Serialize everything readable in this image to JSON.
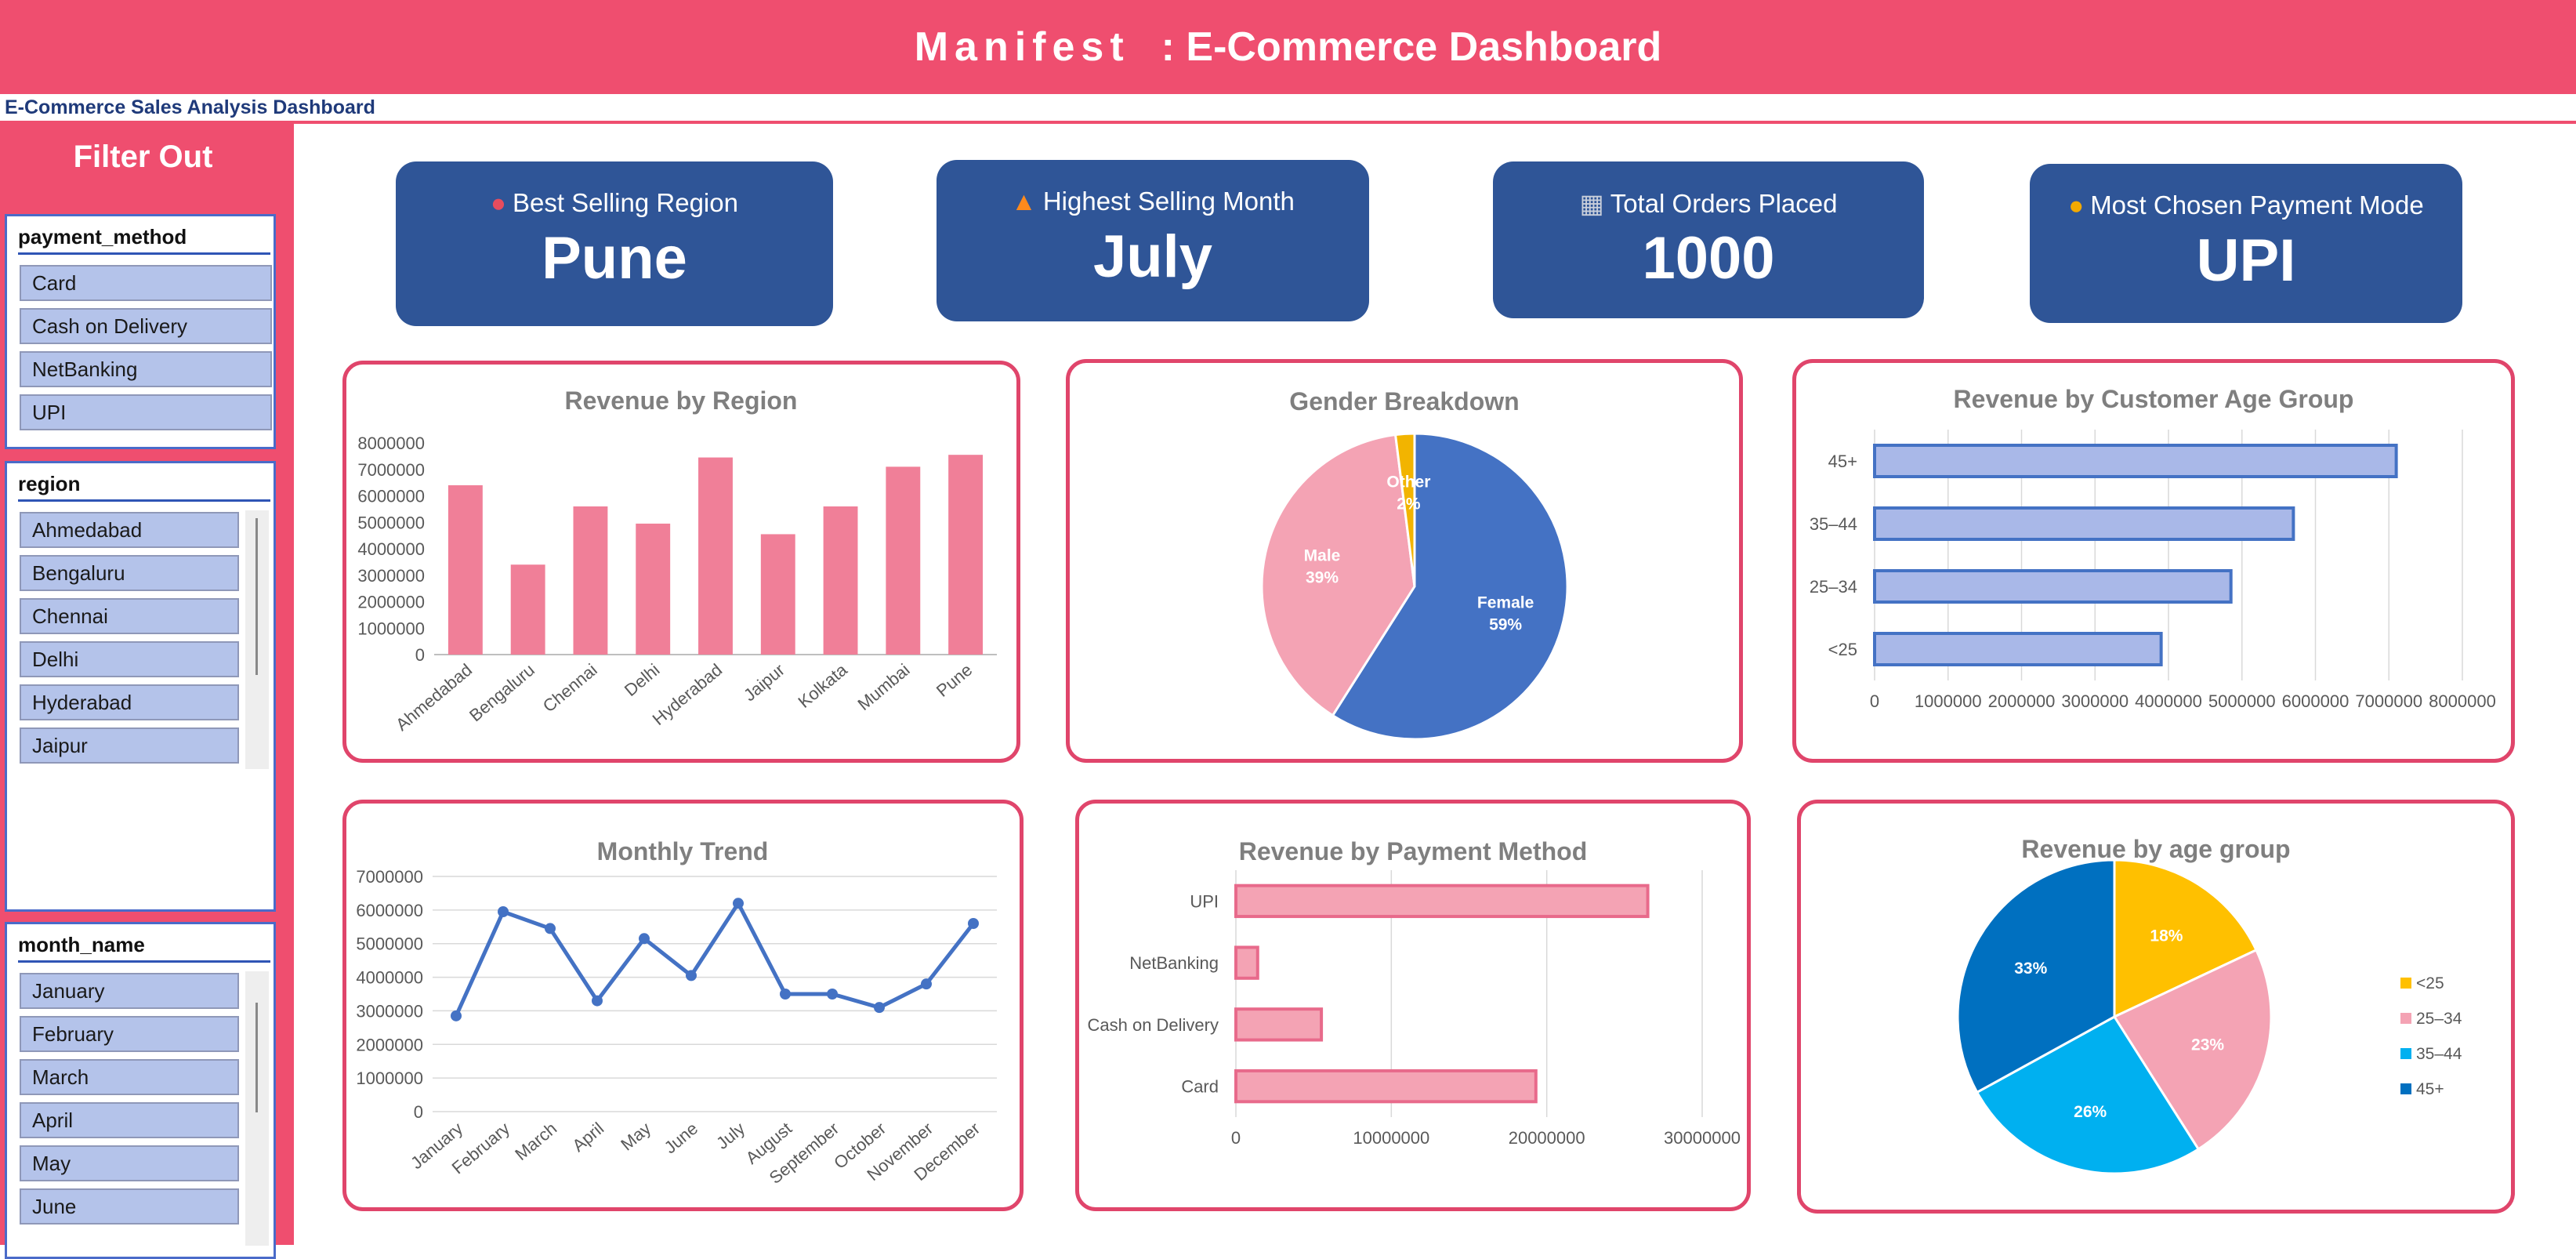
{
  "header": {
    "brand": "Manifest",
    "title": ": E-Commerce Dashboard",
    "subtitle": "E-Commerce Sales Analysis Dashboard",
    "color": "#ef4e6f"
  },
  "sidebar": {
    "title": "Filter Out",
    "slicers": [
      {
        "field": "payment_method",
        "items": [
          "Card",
          "Cash on Delivery",
          "NetBanking",
          "UPI"
        ]
      },
      {
        "field": "region",
        "items": [
          "Ahmedabad",
          "Bengaluru",
          "Chennai",
          "Delhi",
          "Hyderabad",
          "Jaipur"
        ]
      },
      {
        "field": "month_name",
        "items": [
          "January",
          "February",
          "March",
          "April",
          "May",
          "June"
        ]
      }
    ]
  },
  "kpis": [
    {
      "icon": "map-pin-icon",
      "label": "Best Selling Region",
      "value": "Pune"
    },
    {
      "icon": "fire-icon",
      "label": "Highest Selling Month",
      "value": "July"
    },
    {
      "icon": "keyboard-icon",
      "label": "Total Orders Placed",
      "value": "1000"
    },
    {
      "icon": "coin-icon",
      "label": "Most Chosen Payment Mode",
      "value": "UPI"
    }
  ],
  "chart_data": [
    {
      "id": "revenue-by-region",
      "type": "bar",
      "title": "Revenue by Region",
      "categories": [
        "Ahmedabad",
        "Bengaluru",
        "Chennai",
        "Delhi",
        "Hyderabad",
        "Jaipur",
        "Kolkata",
        "Mumbai",
        "Pune"
      ],
      "values": [
        6400000,
        3400000,
        5600000,
        4950000,
        7450000,
        4550000,
        5600000,
        7100000,
        7550000
      ],
      "ylim": [
        0,
        8000000
      ],
      "yticks": [
        0,
        1000000,
        2000000,
        3000000,
        4000000,
        5000000,
        6000000,
        7000000,
        8000000
      ],
      "grid": false,
      "color": "#f07f98"
    },
    {
      "id": "gender-breakdown",
      "type": "pie",
      "title": "Gender Breakdown",
      "slices": [
        {
          "label": "Female",
          "pct_label": "59%",
          "value": 59,
          "color": "#4472c4"
        },
        {
          "label": "Male",
          "pct_label": "39%",
          "value": 39,
          "color": "#f4a3b4"
        },
        {
          "label": "Other",
          "pct_label": "2%",
          "value": 2,
          "color": "#f2b400"
        }
      ]
    },
    {
      "id": "revenue-by-age-group-bar",
      "type": "bar",
      "orientation": "horizontal",
      "title": "Revenue by Customer Age Group",
      "categories": [
        "45+",
        "35–44",
        "25–34",
        "<25"
      ],
      "values": [
        7100000,
        5700000,
        4850000,
        3900000
      ],
      "xlim": [
        0,
        8000000
      ],
      "xticks": [
        0,
        1000000,
        2000000,
        3000000,
        4000000,
        5000000,
        6000000,
        7000000,
        8000000
      ],
      "grid": true,
      "color": "#a9b8e8"
    },
    {
      "id": "monthly-trend",
      "type": "line",
      "title": "Monthly Trend",
      "categories": [
        "January",
        "February",
        "March",
        "April",
        "May",
        "June",
        "July",
        "August",
        "September",
        "October",
        "November",
        "December"
      ],
      "values": [
        2850000,
        5950000,
        5450000,
        3300000,
        5150000,
        4050000,
        6200000,
        3500000,
        3500000,
        3100000,
        3800000,
        5600000
      ],
      "ylim": [
        0,
        7000000
      ],
      "yticks": [
        0,
        1000000,
        2000000,
        3000000,
        4000000,
        5000000,
        6000000,
        7000000
      ],
      "grid": true,
      "color": "#4472c4"
    },
    {
      "id": "revenue-by-payment-method",
      "type": "bar",
      "orientation": "horizontal",
      "title": "Revenue by Payment Method",
      "categories": [
        "UPI",
        "NetBanking",
        "Cash on Delivery",
        "Card"
      ],
      "values": [
        26500000,
        1400000,
        5500000,
        19300000
      ],
      "xlim": [
        0,
        30000000
      ],
      "xticks": [
        0,
        10000000,
        20000000,
        30000000
      ],
      "grid": true,
      "color": "#f4a3b4"
    },
    {
      "id": "revenue-by-age-group-pie",
      "type": "pie",
      "title": "Revenue by age group",
      "legend": "right",
      "slices": [
        {
          "label": "<25",
          "pct_label": "18%",
          "value": 18,
          "color": "#ffc000"
        },
        {
          "label": "25–34",
          "pct_label": "23%",
          "value": 23,
          "color": "#f4a3b4"
        },
        {
          "label": "35–44",
          "pct_label": "26%",
          "value": 26,
          "color": "#00b0f0"
        },
        {
          "label": "45+",
          "pct_label": "33%",
          "value": 33,
          "color": "#0070c0"
        }
      ]
    }
  ]
}
